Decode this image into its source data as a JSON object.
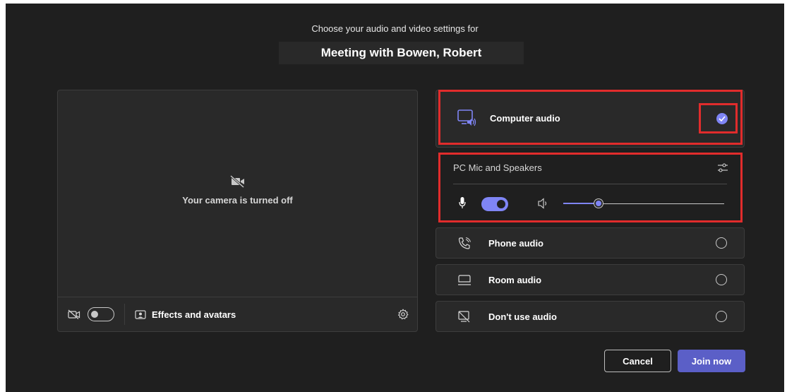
{
  "header": {
    "subtitle": "Choose your audio and video settings for",
    "meeting_title": "Meeting with Bowen, Robert"
  },
  "preview": {
    "camera_status": "Your camera is turned off",
    "camera_icon": "video-off-icon",
    "camera_toggle_on": false,
    "effects_label": "Effects and avatars"
  },
  "audio": {
    "options": [
      {
        "label": "Computer audio",
        "icon": "computer-audio-icon",
        "selected": true
      },
      {
        "label": "Phone audio",
        "icon": "phone-icon",
        "selected": false
      },
      {
        "label": "Room audio",
        "icon": "room-icon",
        "selected": false
      },
      {
        "label": "Don't use audio",
        "icon": "no-audio-icon",
        "selected": false
      }
    ],
    "device": {
      "label": "PC Mic and Speakers",
      "mic_on": true,
      "speaker_volume": 0.22
    }
  },
  "actions": {
    "cancel_label": "Cancel",
    "join_label": "Join now"
  },
  "colors": {
    "background": "#1f1f1f",
    "panel": "#292929",
    "accent": "#7f85f5",
    "primary_button": "#5b5fc7",
    "highlight": "#e12c2c"
  }
}
